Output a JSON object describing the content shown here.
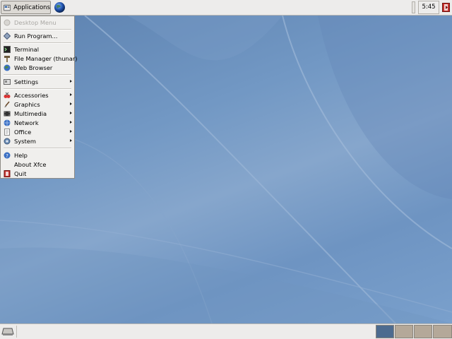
{
  "top_panel": {
    "applications_label": "Applications",
    "clock": "5:45"
  },
  "menu": {
    "items": [
      {
        "label": "Desktop Menu",
        "icon": "desktop-menu-icon",
        "disabled": true
      },
      {
        "label": "Run Program...",
        "icon": "run-icon"
      },
      {
        "label": "Terminal",
        "icon": "terminal-icon"
      },
      {
        "label": "File Manager (thunar)",
        "icon": "file-manager-icon"
      },
      {
        "label": "Web Browser",
        "icon": "web-browser-icon"
      },
      {
        "label": "Settings",
        "icon": "settings-icon",
        "submenu": true
      },
      {
        "label": "Accessories",
        "icon": "accessories-icon",
        "submenu": true
      },
      {
        "label": "Graphics",
        "icon": "graphics-icon",
        "submenu": true
      },
      {
        "label": "Multimedia",
        "icon": "multimedia-icon",
        "submenu": true
      },
      {
        "label": "Network",
        "icon": "network-icon",
        "submenu": true
      },
      {
        "label": "Office",
        "icon": "office-icon",
        "submenu": true
      },
      {
        "label": "System",
        "icon": "system-icon",
        "submenu": true
      },
      {
        "label": "Help",
        "icon": "help-icon"
      },
      {
        "label": "About Xfce",
        "icon": "about-icon"
      },
      {
        "label": "Quit",
        "icon": "quit-icon"
      }
    ]
  },
  "bottom_panel": {
    "workspaces": [
      {
        "active": true
      },
      {
        "active": false
      },
      {
        "active": false
      },
      {
        "active": false
      }
    ]
  },
  "colors": {
    "panel": "#edeceb",
    "desktop": "#6f93c0",
    "active_workspace": "#4d6b8f",
    "inactive_workspace": "#b4a899"
  }
}
